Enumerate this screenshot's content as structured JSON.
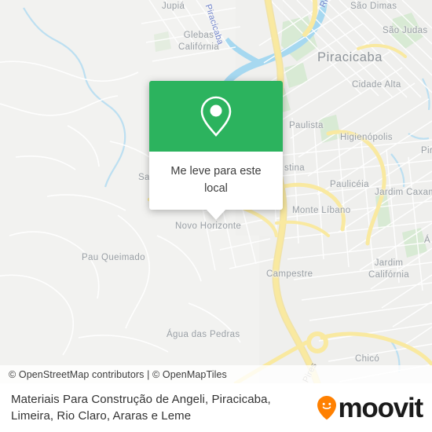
{
  "map": {
    "attribution": "© OpenStreetMap contributors | © OpenMapTiles",
    "labels": [
      {
        "id": "jupia",
        "text": "Jupiá",
        "kind": "place"
      },
      {
        "id": "glebas-california",
        "text": "Glebas Califórnia",
        "kind": "place"
      },
      {
        "id": "sao-dimas",
        "text": "São Dimas",
        "kind": "place"
      },
      {
        "id": "sao-judas",
        "text": "São Judas",
        "kind": "place"
      },
      {
        "id": "piracicaba",
        "text": "Piracicaba",
        "kind": "city"
      },
      {
        "id": "cidade-alta",
        "text": "Cidade Alta",
        "kind": "place"
      },
      {
        "id": "paulista",
        "text": "Paulista",
        "kind": "place"
      },
      {
        "id": "higienopolis",
        "text": "Higienópolis",
        "kind": "place"
      },
      {
        "id": "pir-truncated",
        "text": "Pir",
        "kind": "place"
      },
      {
        "id": "cristina",
        "text": "stina",
        "kind": "place"
      },
      {
        "id": "pauliceia",
        "text": "Paulicéia",
        "kind": "place"
      },
      {
        "id": "jardim-caxambu",
        "text": "Jardim Caxam",
        "kind": "place"
      },
      {
        "id": "sa-truncated",
        "text": "Sa",
        "kind": "place"
      },
      {
        "id": "monte-libano",
        "text": "Monte Líbano",
        "kind": "place"
      },
      {
        "id": "novo-horizonte",
        "text": "Novo Horizonte",
        "kind": "place"
      },
      {
        "id": "campestre",
        "text": "Campestre",
        "kind": "place"
      },
      {
        "id": "jardim-california",
        "text": "Jardim Califórnia",
        "kind": "place"
      },
      {
        "id": "a-truncated",
        "text": "Á",
        "kind": "place"
      },
      {
        "id": "pau-queimado",
        "text": "Pau Queimado",
        "kind": "place"
      },
      {
        "id": "agua-das-pedras",
        "text": "Água das Pedras",
        "kind": "place"
      },
      {
        "id": "chico",
        "text": "Chicó",
        "kind": "place"
      },
      {
        "id": "rio-piracicaba-1",
        "text": "Rio Pi",
        "kind": "river"
      },
      {
        "id": "rio-piracicaba-2",
        "text": "Piracicaba",
        "kind": "river"
      },
      {
        "id": "road-pires",
        "text": "o Pires",
        "kind": "road"
      }
    ],
    "colors": {
      "land": "#f2f2f0",
      "water": "#a6d8f0",
      "park": "#d6ead2",
      "road_major": "#f7df8f",
      "road_minor": "#ffffff",
      "label": "#9aa0a6"
    }
  },
  "popup": {
    "icon": "map-pin-icon",
    "message": "Me leve para este local",
    "header_color": "#2cb35e"
  },
  "footer": {
    "title": "Materiais Para Construção de Angeli, Piracicaba, Limeira, Rio Claro, Araras e Leme",
    "brand_name": "moovit",
    "brand_color": "#ff8000"
  }
}
